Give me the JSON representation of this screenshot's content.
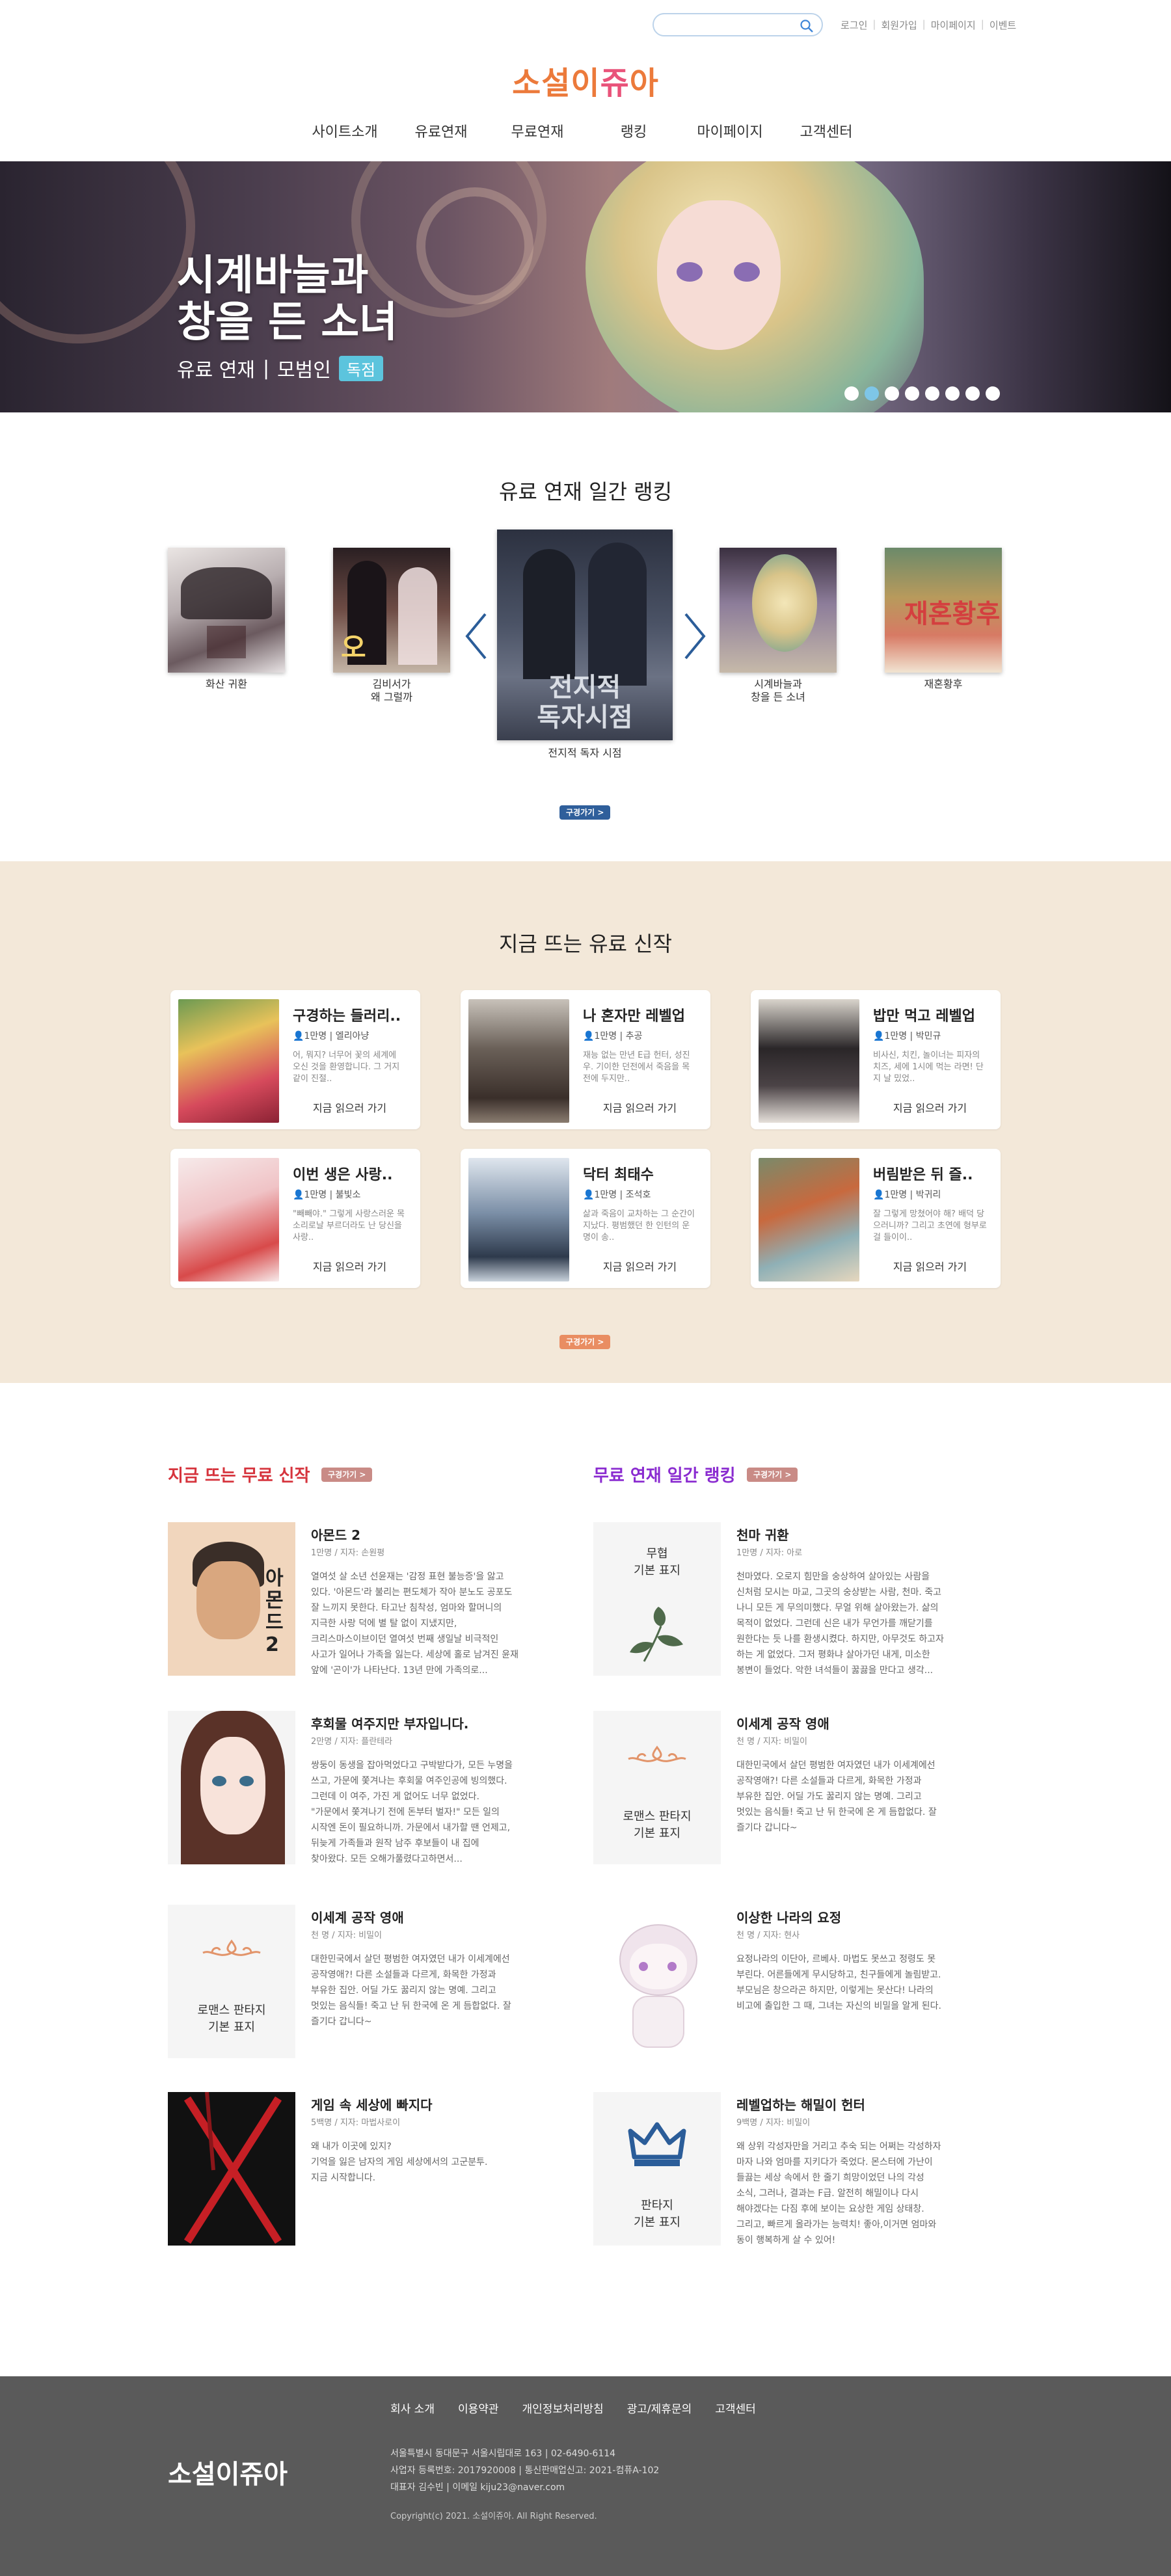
{
  "header": {
    "search_placeholder": "",
    "top_links": [
      "로그인",
      "회원가입",
      "마이페이지",
      "이벤트"
    ],
    "logo_a": "소설이",
    "logo_b": "쥬",
    "logo_c": "아",
    "nav": [
      "사이트소개",
      "유료연재",
      "무료연재",
      "랭킹",
      "마이페이지",
      "고객센터"
    ]
  },
  "banner": {
    "title_line1": "시계바늘과",
    "title_line2": "창을 든 소녀",
    "subtitle": "유료 연재",
    "separator": "|",
    "author": "모범인",
    "badge": "독점",
    "dots_count": 8,
    "active_dot": 1
  },
  "paid_ranking": {
    "title": "유료 연재 일간 랭킹",
    "books": [
      {
        "label": "화산 귀환"
      },
      {
        "label": "김비서가\n왜 그럴까"
      },
      {
        "label": "전지적 독자 시점",
        "cover_text": "전지적 독자시점"
      },
      {
        "label": "시계바늘과\n창을 든 소녀"
      },
      {
        "label": "재혼황후",
        "cover_text": "재혼황후"
      }
    ],
    "more": "구경가기 >"
  },
  "paid_new": {
    "title": "지금 뜨는 유료 신작",
    "cards": [
      {
        "title": "구경하는 들러리..",
        "meta": "1만명 | 엘리아냥",
        "desc": "어, 뭐지? 너무어 꽃의 세계에 오신 것을 환영합니다. 그 거지같이 진절..",
        "go": "지금 읽으러 가기"
      },
      {
        "title": "나 혼자만 레벨업",
        "meta": "1만명 | 추공",
        "desc": "재능 없는 만년 E급 헌터, 성진우. 기이한 던전에서 죽음을 목전에 두지만..",
        "go": "지금 읽으러 가기"
      },
      {
        "title": "밥만 먹고 레벨업",
        "meta": "1만명 | 박민규",
        "desc": "비사신, 치킨, 놀이너는 피자의 치즈, 세에 1시에 먹는 라면! 단지 날 밌었..",
        "go": "지금 읽으러 가기"
      },
      {
        "title": "이번 생은 사랑..",
        "meta": "1만명 | 불빛소",
        "desc": "\"빼빼야.\" 그렇게 사랑스러운 목소리로날 부르더라도 난 당신을 사랑..",
        "go": "지금 읽으러 가기"
      },
      {
        "title": "닥터 최태수",
        "meta": "1만명 | 조석호",
        "desc": "삶과 죽음이 교차하는 그 순간이 지났다. 평범했던 한 인턴의 운명이 송..",
        "go": "지금 읽으러 가기"
      },
      {
        "title": "버림받은 뒤 즐..",
        "meta": "1만명 | 박귀리",
        "desc": "잘 그렇게 망쳤어야 해? 배덕 당으러니까? 그리고 초연에 형부로 걸 들이이..",
        "go": "지금 읽으러 가기"
      }
    ],
    "more": "구경가기 >"
  },
  "free_new": {
    "title": "지금 뜨는 무료 신작",
    "more": "구경가기 >",
    "items": [
      {
        "title": "아몬드 2",
        "meta": "1만명 / 지자: 손원평",
        "desc": "열여섯 살 소년 선윤재는 '감정 표현 불능증'을 앓고\n있다. '아몬드'라 불리는 편도체가 작아 분노도 공포도\n잘 느끼지 못한다. 타고난 침착성, 엄마와 할머니의\n지극한 사랑 덕에 별 탈 없이 지냈지만,\n크리스마스이브이던 열여섯 번째 생일날 비극적인\n사고가 일어나 가족을 잃는다. 세상에 홀로 남겨진 윤재\n앞에 '곤이'가 나타난다. 13년 만에 가족의로..."
      },
      {
        "title": "후회물 여주지만 부자입니다.",
        "meta": "2만명 / 지자: 플란테라",
        "desc": "쌍둥이 동생을 잡아먹었다고 구박받다가, 모든 누명을\n쓰고, 가문에 쫓겨나는 후회물 여주인공에 빙의했다.\n그런데 이 여주, 가진 게 없어도 너무 없었다.\n\"가문에서 쫓겨나기 전에 돈부터 벌자!\" 모든 일의\n시작엔 돈이 필요하니까. 가문에서 내가할 땐 언제고,\n뒤늦게 가족들과 원작 남주 후보들이 내 집에\n찾아왔다. 모든 오해가풀렸다고하면서..."
      },
      {
        "title": "이세계 공작 영애",
        "meta": "천 명 / 지자: 비밀이",
        "desc": "대한민국에서 살던 평범한 여자였던 내가 이세계에선\n공작영애?! 다른 소설들과 다르게, 화목한 가정과\n부유한 집안. 어딜 가도 꿇리지 않는 명예. 그리고\n멋있는 음식들! 죽고 난 뒤 한국에 온 게 듬합없다. 잘\n즐기다 갑니다~",
        "placeholder": "로맨스 판타지\n기본 표지"
      },
      {
        "title": "게임 속 세상에 빠지다",
        "meta": "5백명 / 지자: 마법사로이",
        "desc": "왜 내가 이곳에 있지?\n기억을 잃은 남자의 게임 세상에서의 고군분투.\n지금 시작합니다."
      }
    ]
  },
  "free_ranking": {
    "title": "무료 연재 일간 랭킹",
    "more": "구경가기 >",
    "items": [
      {
        "title": "천마 귀환",
        "meta": "1만명 / 지자: 아로",
        "desc": "천마였다. 오로지 힘만을 숭상하여 살아있는 사람을\n신처럼 모시는 마교, 그곳의 숭상받는 사람, 천마. 죽고\n나니 모든 게 무의미했다. 무얼 위해 살아왔는가. 삶의\n목적이 없었다. 그런데 신은 내가 무언가를 깨닫기를\n원한다는 듯 나를 환생시켰다. 하지만, 아무것도 하고자\n하는 게 없었다. 그저 평화냐 살아가던 내게, 미소한\n봉변이 들었다. 악한 녀석들이 꿇끓을 만다고 생각...",
        "placeholder": "무협\n기본 표지"
      },
      {
        "title": "이세계 공작 영애",
        "meta": "천 명 / 지자: 비밀이",
        "desc": "대한민국에서 살던 평범한 여자였던 내가 이세계에선\n공작영애?! 다른 소설들과 다르게, 화목한 가정과\n부유한 집안. 어딜 가도 꿇리지 않는 명예. 그리고\n멋있는 음식들! 죽고 난 뒤 한국에 온 게 듬합없다. 잘\n즐기다 갑니다~",
        "placeholder": "로맨스 판타지\n기본 표지"
      },
      {
        "title": "이상한 나라의 요정",
        "meta": "천 명 / 지자: 현사",
        "desc": "요정나라의 이단아, 르베사. 마법도 못쓰고 정령도 못\n부린다. 어른들에게 무시당하고, 친구들에게 놀림받고.\n부모님은 창으라곤 하지만, 이렇게는 못산다! 나라의\n비고에 출입한 그 때, 그녀는 자신의 비밀을 알게 된다."
      },
      {
        "title": "레벨업하는 해밀이 헌터",
        "meta": "9백명 / 지자: 비밀이",
        "desc": "왜 상위 각성자만을 거리고 추숙 되는 어쩌는 각성하자\n마자 나와 엄마를 지키다가 죽었다. 몬스터에 가난이\n들끓는 세상 속에서 한 줄기 희망이었던 나의 각성\n소식, 그러나, 결과는 F급. 알전히 해밀이나 다시\n해야겠다는 다짐 후에 보이는 요상한 게임 상태창.\n그리고, 빠르게 올라가는 능력치! 좋아,이거면 엄마와\n동이 행복하게 살 수 있어!",
        "placeholder": "판타지\n기본 표지"
      }
    ]
  },
  "footer": {
    "nav": [
      "회사 소개",
      "이용약관",
      "개인정보처리방침",
      "광고/제휴문의",
      "고객센터"
    ],
    "logo": "소설이쥬아",
    "info1": "서울특별시 동대문구 서울시립대로 163   |   02-6490-6114",
    "info2": "사업자 등록번호: 2017920008   |   통신판매업신고: 2021-컴퓨A-102",
    "info3": "대표자 김수빈 | 이메일 kiju23@naver.com",
    "copyright": "Copyright(c) 2021. 소설이쥬아. All Right Reserved."
  },
  "colors": {
    "accent_orange": "#ec7a3b",
    "accent_red": "#d6343d",
    "accent_purple": "#8a2bd0",
    "blue_button": "#2f5f9b",
    "orange_button": "#e98d62",
    "pink_button": "#c98b86",
    "beige": "#f3e8d9",
    "footer": "#5a5a5a"
  }
}
